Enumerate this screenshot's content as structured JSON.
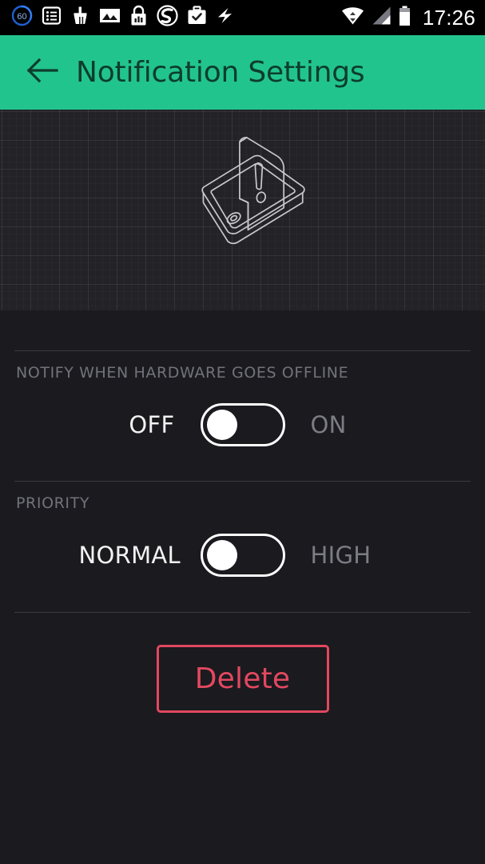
{
  "statusbar": {
    "time": "17:26",
    "battery_badge": "60",
    "left_icons": [
      {
        "name": "battery-saver-60-icon",
        "label": "60"
      },
      {
        "name": "task-list-icon",
        "label": ""
      },
      {
        "name": "cleaner-broom-icon",
        "label": ""
      },
      {
        "name": "gallery-image-icon",
        "label": ""
      },
      {
        "name": "lock-stats-icon",
        "label": ""
      },
      {
        "name": "s-circle-logo-icon",
        "label": ""
      },
      {
        "name": "briefcase-check-icon",
        "label": ""
      },
      {
        "name": "lightning-bolt-icon",
        "label": ""
      }
    ],
    "right_icons": [
      {
        "name": "wifi-icon",
        "label": ""
      },
      {
        "name": "cellular-signal-icon",
        "label": ""
      },
      {
        "name": "battery-icon",
        "label": ""
      }
    ]
  },
  "appbar": {
    "back_label": "Back",
    "title": "Notification Settings",
    "background_color": "#22c48e",
    "title_color": "#0d3d2c"
  },
  "hero": {
    "illustration": "phone-notification-alert-illustration",
    "background_color": "#232327",
    "line_color": "#c8c8cc"
  },
  "sections": [
    {
      "label": "NOTIFY WHEN HARDWARE GOES OFFLINE",
      "toggle": {
        "name": "notify-offline-toggle",
        "left_label": "OFF",
        "right_label": "ON",
        "state": "off"
      }
    },
    {
      "label": "PRIORITY",
      "toggle": {
        "name": "priority-toggle",
        "left_label": "NORMAL",
        "right_label": "HIGH",
        "state": "normal"
      }
    }
  ],
  "delete": {
    "label": "Delete",
    "color": "#e2485f"
  },
  "theme": {
    "background": "#1a1a1f",
    "accent": "#22c48e",
    "danger": "#e2485f",
    "muted_text": "#72727a",
    "active_text": "#f2f2f2"
  }
}
